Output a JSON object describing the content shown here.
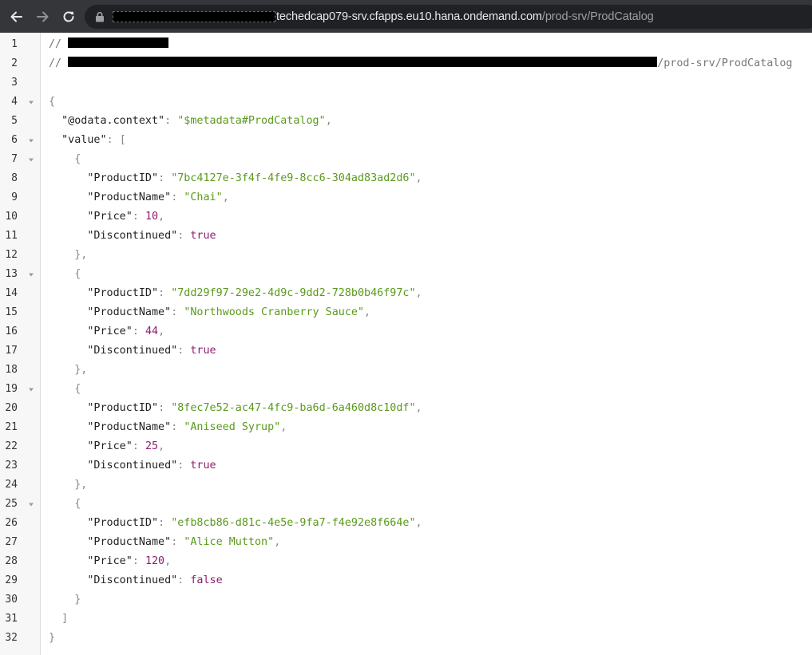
{
  "browser": {
    "url_host": "techedcap079-srv.cfapps.eu10.hana.ondemand.com",
    "url_path": "/prod-srv/ProdCatalog"
  },
  "viewer": {
    "comment_prefix": "//",
    "comment_path": "/prod-srv/ProdCatalog",
    "context_key": "\"@odata.context\"",
    "context_value": "\"$metadata#ProdCatalog\"",
    "value_key": "\"value\"",
    "line_numbers": [
      "1",
      "2",
      "3",
      "4",
      "5",
      "6",
      "7",
      "8",
      "9",
      "10",
      "11",
      "12",
      "13",
      "14",
      "15",
      "16",
      "17",
      "18",
      "19",
      "20",
      "21",
      "22",
      "23",
      "24",
      "25",
      "26",
      "27",
      "28",
      "29",
      "30",
      "31",
      "32"
    ],
    "products": [
      {
        "ProductID": "\"7bc4127e-3f4f-4fe9-8cc6-304ad83ad2d6\"",
        "ProductName": "\"Chai\"",
        "Price": "10",
        "Discontinued": "true"
      },
      {
        "ProductID": "\"7dd29f97-29e2-4d9c-9dd2-728b0b46f97c\"",
        "ProductName": "\"Northwoods Cranberry Sauce\"",
        "Price": "44",
        "Discontinued": "true"
      },
      {
        "ProductID": "\"8fec7e52-ac47-4fc9-ba6d-6a460d8c10df\"",
        "ProductName": "\"Aniseed Syrup\"",
        "Price": "25",
        "Discontinued": "true"
      },
      {
        "ProductID": "\"efb8cb86-d81c-4e5e-9fa7-f4e92e8f664e\"",
        "ProductName": "\"Alice Mutton\"",
        "Price": "120",
        "Discontinued": "false"
      }
    ],
    "keys": {
      "id": "\"ProductID\"",
      "name": "\"ProductName\"",
      "price": "\"Price\"",
      "disc": "\"Discontinued\""
    },
    "punct": {
      "open_brace": "{",
      "close_brace": "}",
      "close_brace_comma": "},",
      "open_bracket": "[",
      "close_bracket": "]",
      "colon": ": ",
      "comma": ","
    }
  },
  "colors": {
    "toolbar": "#35363a",
    "omnibox": "#202124",
    "string": "#5a9a1b",
    "number": "#8c1f6e",
    "gutter": "#f7f7f7"
  },
  "icons": {
    "back": "back-arrow-icon",
    "forward": "forward-arrow-icon",
    "reload": "reload-icon",
    "lock": "lock-icon",
    "fold": "fold-caret-icon"
  }
}
